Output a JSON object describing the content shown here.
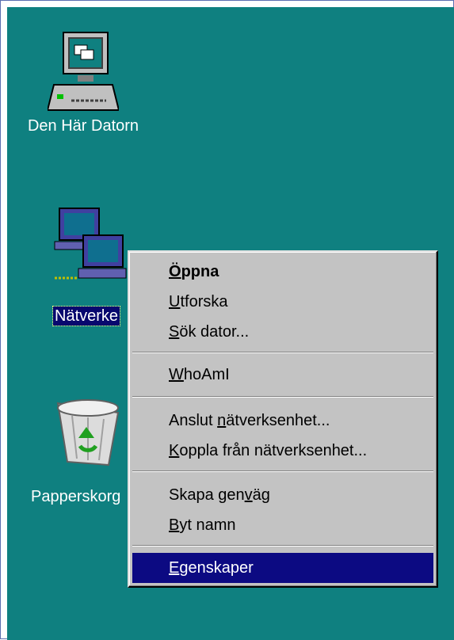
{
  "desktop": {
    "background": "#0f8080",
    "icons": [
      {
        "label": "Den Här Datorn",
        "icon": "my-computer-icon"
      },
      {
        "label": "Nätverke",
        "icon": "network-neighborhood-icon",
        "selected": true
      },
      {
        "label": "Papperskorg",
        "icon": "recycle-bin-icon"
      }
    ]
  },
  "context_menu": {
    "highlight_color": "#0c0a82",
    "items": [
      {
        "label": "Öppna",
        "default": true
      },
      {
        "label": "Utforska"
      },
      {
        "label": "Sök dator..."
      },
      {
        "label": "WhoAmI"
      },
      {
        "label": "Anslut nätverksenhet..."
      },
      {
        "label": "Koppla från nätverksenhet..."
      },
      {
        "label": "Skapa genväg"
      },
      {
        "label": "Byt namn"
      },
      {
        "label": "Egenskaper",
        "highlighted": true
      }
    ]
  }
}
